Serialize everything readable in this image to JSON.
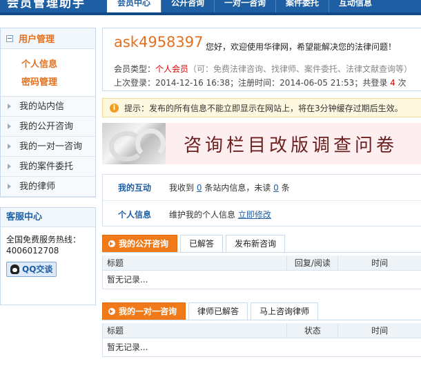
{
  "header": {
    "site_title": "会员管理助手",
    "nav": [
      "会员中心",
      "公开咨询",
      "一对一咨询",
      "案件委托",
      "互动信息"
    ]
  },
  "sidebar": {
    "user_section_title": "用户管理",
    "sub_items": [
      "个人信息",
      "密码管理"
    ],
    "links": [
      "我的站内信",
      "我的公开咨询",
      "我的一对一咨询",
      "我的案件委托",
      "我的律师"
    ],
    "service_title": "客服中心",
    "hotline_label": "全国免费服务热线：",
    "hotline_number": "4006012708",
    "qq_label": "QQ交谈"
  },
  "welcome": {
    "username": "ask4958397",
    "greeting": "您好，欢迎使用华律网，希望能解决您的法律问题！",
    "member_type_label": "会员类型：",
    "member_type": "个人会员",
    "member_note": "（可：免费法律咨询、找律师、案件委托、法律文献查询等）",
    "last_login_label": "上次登录：",
    "last_login": "2014-12-16 16:38",
    "register_label": "；注册时间：",
    "register_time": "2014-06-05 21:53",
    "login_count_label": "；共登录",
    "login_count": "4",
    "login_count_unit": "次"
  },
  "tip": {
    "icon": "i",
    "text": "提示：发布的所有信息不能立即显示在网站上，将在3分钟缓存过期后生效。"
  },
  "banner": {
    "text": "咨询栏目改版调查问卷"
  },
  "interaction": {
    "row1_label": "我的互动",
    "row1_prefix": "我收到",
    "row1_count1": "0",
    "row1_middle": "条站内信息，未读",
    "row1_count2": "0",
    "row1_suffix": "条",
    "row2_label": "个人信息",
    "row2_text": "维护我的个人信息",
    "row2_link": "立即修改"
  },
  "public_consult": {
    "tabs": [
      "我的公开咨询",
      "已解答",
      "发布新咨询"
    ],
    "columns": [
      "标题",
      "回复/阅读",
      "时间"
    ],
    "empty": "暂无记录..."
  },
  "private_consult": {
    "tabs": [
      "我的一对一咨询",
      "律师已解答",
      "马上咨询律师"
    ],
    "columns": [
      "标题",
      "状态",
      "时间"
    ],
    "empty": "暂无记录..."
  }
}
